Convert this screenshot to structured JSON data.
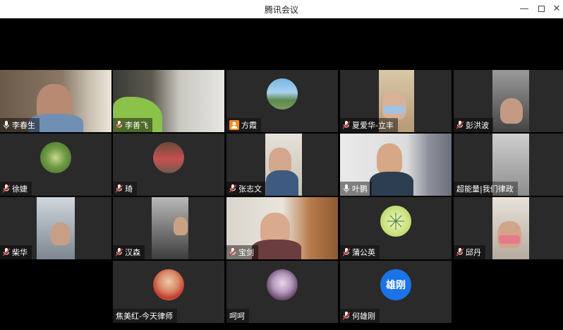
{
  "window": {
    "title": "腾讯会议",
    "minimize_glyph": "—",
    "close_glyph": "✕"
  },
  "participants": [
    {
      "name": "李春生",
      "icon": "mic-icon",
      "active": true
    },
    {
      "name": "李善飞",
      "icon": "mic-muted-icon"
    },
    {
      "name": "方霞",
      "icon": "user-badge-icon"
    },
    {
      "name": "夏爱华-立丰",
      "icon": "mic-muted-icon"
    },
    {
      "name": "彭洪波",
      "icon": "mic-muted-icon"
    },
    {
      "name": "徐婕",
      "icon": "mic-muted-icon"
    },
    {
      "name": "琦",
      "icon": "mic-muted-icon"
    },
    {
      "name": "张志文",
      "icon": "mic-muted-icon"
    },
    {
      "name": "叶鹏",
      "icon": "mic-icon"
    },
    {
      "name": "超能量|我们律政",
      "icon": "none"
    },
    {
      "name": "柴华",
      "icon": "mic-muted-icon"
    },
    {
      "name": "汉森",
      "icon": "mic-muted-icon"
    },
    {
      "name": "宝剑",
      "icon": "mic-muted-icon"
    },
    {
      "name": "蒲公英",
      "icon": "mic-muted-icon"
    },
    {
      "name": "邱丹",
      "icon": "mic-muted-icon"
    },
    {
      "name": "焦美红-今天律师",
      "icon": "none"
    },
    {
      "name": "呵呵",
      "icon": "none"
    },
    {
      "name": "何雄刚",
      "icon": "mic-muted-icon",
      "avatar_text": "雄刚"
    }
  ],
  "colors": {
    "active_border": "#1fd37a",
    "tile_bg": "#2a2a2a",
    "avatar_blue": "#1a73e8",
    "badge_orange": "#f28b22"
  }
}
